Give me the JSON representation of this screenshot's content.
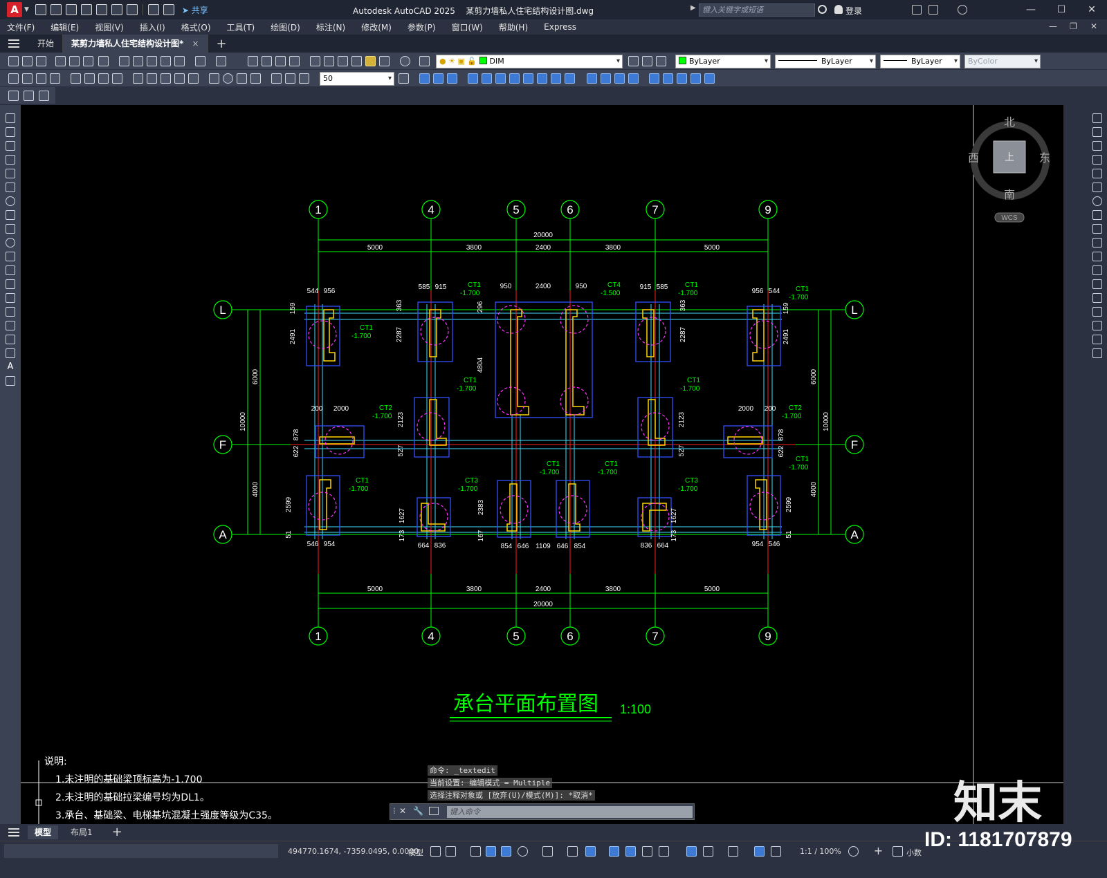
{
  "titlebar": {
    "app_letter": "A",
    "share_label": "共享",
    "app_name": "Autodesk AutoCAD 2025",
    "file_name": "某剪力墙私人住宅结构设计图.dwg",
    "search_placeholder": "键入关键字或短语",
    "login_label": "登录"
  },
  "menu": {
    "items": [
      "文件(F)",
      "编辑(E)",
      "视图(V)",
      "插入(I)",
      "格式(O)",
      "工具(T)",
      "绘图(D)",
      "标注(N)",
      "修改(M)",
      "参数(P)",
      "窗口(W)",
      "帮助(H)",
      "Express"
    ]
  },
  "tabs": {
    "start": "开始",
    "doc": "某剪力墙私人住宅结构设计图*",
    "close": "×",
    "add": "+"
  },
  "toolbar": {
    "layer": "DIM",
    "color": "ByLayer",
    "linetype": "ByLayer",
    "lineweight": "ByLayer",
    "plotstyle": "ByColor",
    "dim_scale": "50",
    "layer_color": "#00ff00"
  },
  "viewcube": {
    "north": "北",
    "south": "南",
    "east": "东",
    "west": "西",
    "face": "上",
    "wcs": "WCS"
  },
  "drawing": {
    "axes_x": [
      "1",
      "4",
      "5",
      "6",
      "7",
      "9"
    ],
    "axes_y": [
      "L",
      "F",
      "A"
    ],
    "dim_total": "20000",
    "dim_spans": [
      "5000",
      "3800",
      "2400",
      "3800",
      "5000"
    ],
    "dim_left": [
      "6000",
      "4000",
      "10000"
    ],
    "dim_right": [
      "6000",
      "4000",
      "10000"
    ],
    "title": "承台平面布置图",
    "scale": "1:100",
    "notes_title": "说明:",
    "notes": [
      "1.未注明的基础梁顶标高为-1.700",
      "2.未注明的基础拉梁编号均为DL1。",
      "3.承台、基础梁、电梯基坑混凝土强度等级为C35。"
    ],
    "labels": {
      "ct1": "CT1",
      "ct2": "CT2",
      "ct3": "CT3",
      "ct4": "CT4",
      "el1700": "-1.700",
      "el1500": "-1.500",
      "d544": "544",
      "d956": "956",
      "d585": "585",
      "d915": "915",
      "d950": "950",
      "d2400": "2400",
      "d159": "159",
      "d363": "363",
      "d296": "296",
      "d2491": "2491",
      "d2287": "2287",
      "d4804": "4804",
      "d200": "200",
      "d2000": "2000",
      "d878": "878",
      "d622": "622",
      "d2123": "2123",
      "d527": "527",
      "d2599": "2599",
      "d51": "51",
      "d1627": "1627",
      "d173": "173",
      "d2383": "2383",
      "d167": "167",
      "d546": "546",
      "d954": "954",
      "d664": "664",
      "d836": "836",
      "d854": "854",
      "d646": "646",
      "d1109": "1109"
    }
  },
  "command": {
    "history": [
      "命令: _textedit",
      "当前设置: 编辑模式 = Multiple",
      "选择注释对象或 [放弃(U)/模式(M)]: *取消*"
    ],
    "placeholder": "键入命令"
  },
  "layouts": {
    "model": "模型",
    "layout1": "布局1",
    "add": "+"
  },
  "status": {
    "coords": "494770.1674, -7359.0495, 0.0000",
    "space": "模型",
    "anno_scale": "1:1 / 100%",
    "units": "小数"
  },
  "watermark": {
    "logo": "知末",
    "id": "ID: 1181707879"
  }
}
